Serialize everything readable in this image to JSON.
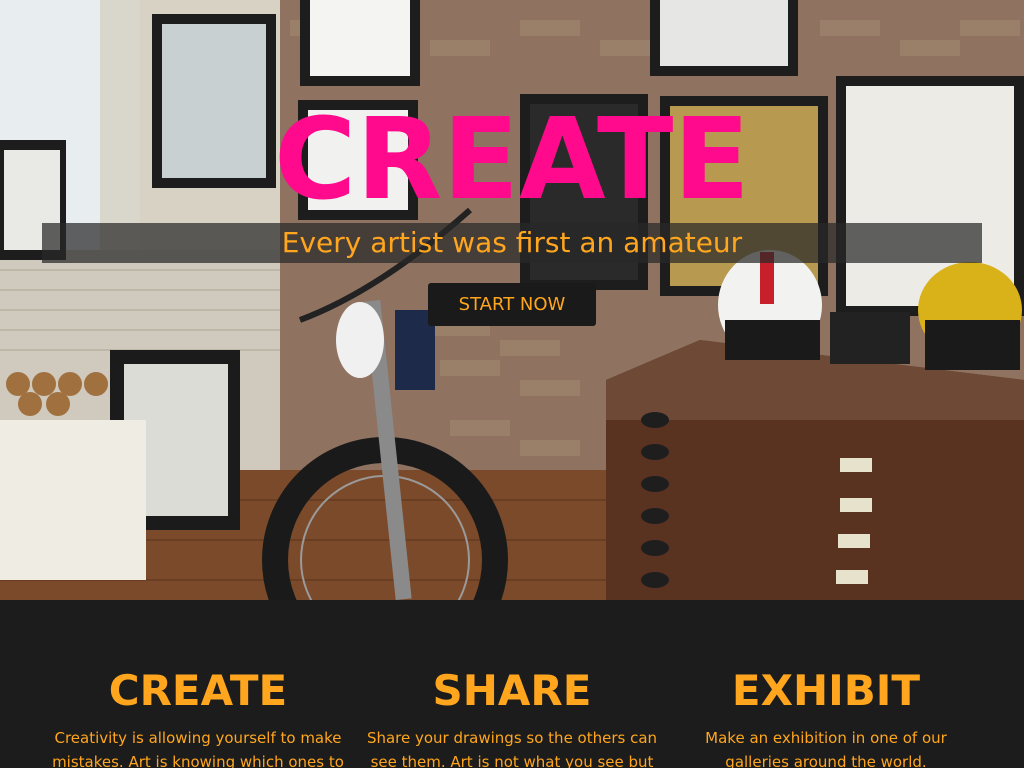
{
  "hero": {
    "title": "CREATE",
    "tagline": "Every artist was first an amateur",
    "cta_label": "START NOW",
    "background": "art-studio-motorcycle-photo"
  },
  "features": [
    {
      "title": "CREATE",
      "text": "Creativity is allowing yourself to make mistakes. Art is knowing which ones to"
    },
    {
      "title": "SHARE",
      "text": "Share your drawings so the others can see them. Art is not what you see but"
    },
    {
      "title": "EXHIBIT",
      "text": "Make an exhibition in one of our galleries around the world."
    }
  ],
  "colors": {
    "title": "#ff0a8c",
    "accent": "#ffa61e",
    "dark_bg": "#1c1c1c",
    "button_bg": "#1a1a1a"
  }
}
